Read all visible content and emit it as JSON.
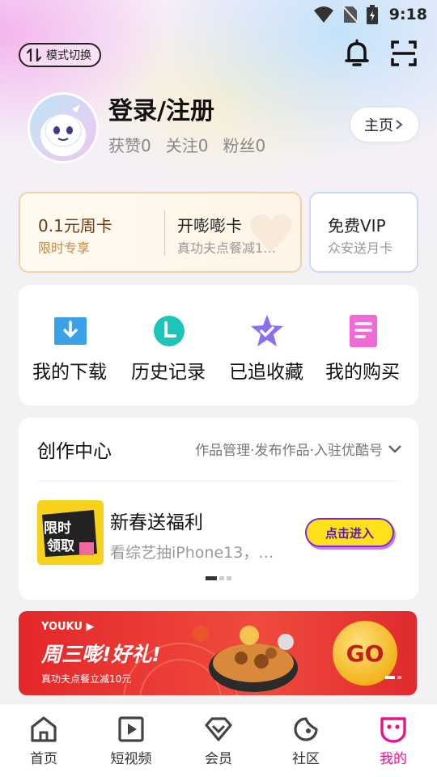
{
  "status_bar": {
    "time": "9:18",
    "icons": [
      "wifi-icon",
      "no-sim-icon",
      "battery-icon"
    ]
  },
  "header": {
    "mode_switch_label": "模式切换"
  },
  "profile": {
    "title": "登录/注册",
    "stats": [
      {
        "label": "获赞",
        "value": "0"
      },
      {
        "label": "关注",
        "value": "0"
      },
      {
        "label": "粉丝",
        "value": "0"
      }
    ],
    "home_button": "主页"
  },
  "cards": {
    "week_card": {
      "title": "0.1元周卡",
      "subtitle": "限时专享"
    },
    "duo_card": {
      "title": "开嘭嘭卡",
      "subtitle": "真功夫点餐减1…"
    },
    "vip_card": {
      "title": "免费VIP",
      "subtitle": "众安送月卡"
    }
  },
  "quick_actions": [
    {
      "label": "我的下载",
      "icon": "download-icon",
      "color": "#3aa0e8"
    },
    {
      "label": "历史记录",
      "icon": "history-icon",
      "color": "#1fc4b8"
    },
    {
      "label": "已追收藏",
      "icon": "favorite-star-icon",
      "color": "#8c6ff0"
    },
    {
      "label": "我的购买",
      "icon": "purchase-icon",
      "color": "#f06ad4"
    }
  ],
  "creation": {
    "title": "创作中心",
    "links": "作品管理·发布作品·入驻优酷号",
    "promo": {
      "thumb_text_1": "限时",
      "thumb_text_2": "领取",
      "title": "新春送福利",
      "subtitle": "看综艺抽iPhone13，…",
      "button": "点击进入"
    }
  },
  "banner": {
    "brand": "YOUKU ▶",
    "title": "周三嘭!好礼!",
    "subtitle": "真功夫点餐立减10元",
    "go_label": "GO"
  },
  "tabbar": {
    "items": [
      {
        "label": "首页",
        "icon": "home-icon"
      },
      {
        "label": "短视频",
        "icon": "short-video-icon"
      },
      {
        "label": "会员",
        "icon": "vip-diamond-icon"
      },
      {
        "label": "社区",
        "icon": "community-icon"
      },
      {
        "label": "我的",
        "icon": "mine-icon",
        "active": true
      }
    ],
    "active_color": "#e5148c"
  }
}
